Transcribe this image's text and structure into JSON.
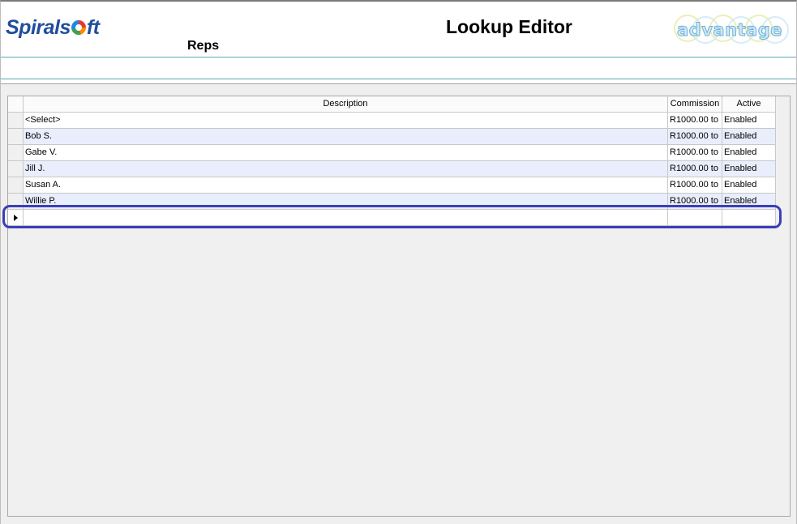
{
  "header": {
    "company_logo": "Spiralsoft",
    "page_title": "Lookup Editor",
    "lookup_name": "Reps",
    "brand_logo": "advantage"
  },
  "grid": {
    "columns": [
      "Description",
      "Commission",
      "Active"
    ],
    "rows": [
      {
        "description": "<Select>",
        "commission": "R1000.00 to",
        "active": "Enabled"
      },
      {
        "description": "Bob S.",
        "commission": "R1000.00 to",
        "active": "Enabled"
      },
      {
        "description": "Gabe V.",
        "commission": "R1000.00 to",
        "active": "Enabled"
      },
      {
        "description": "Jill J.",
        "commission": "R1000.00 to",
        "active": "Enabled"
      },
      {
        "description": "Susan A.",
        "commission": "R1000.00 to",
        "active": "Enabled"
      },
      {
        "description": "Willie P.",
        "commission": "R1000.00 to",
        "active": "Enabled"
      }
    ],
    "new_row": {
      "description": "",
      "commission": "",
      "active": ""
    }
  },
  "colors": {
    "highlight": "#3a3fb8",
    "alt_row": "#e8eefc",
    "divider": "#5aa7b8",
    "logo_blue": "#1f4e9e"
  },
  "icons": {
    "current_row_indicator": "row-pointer-icon"
  }
}
